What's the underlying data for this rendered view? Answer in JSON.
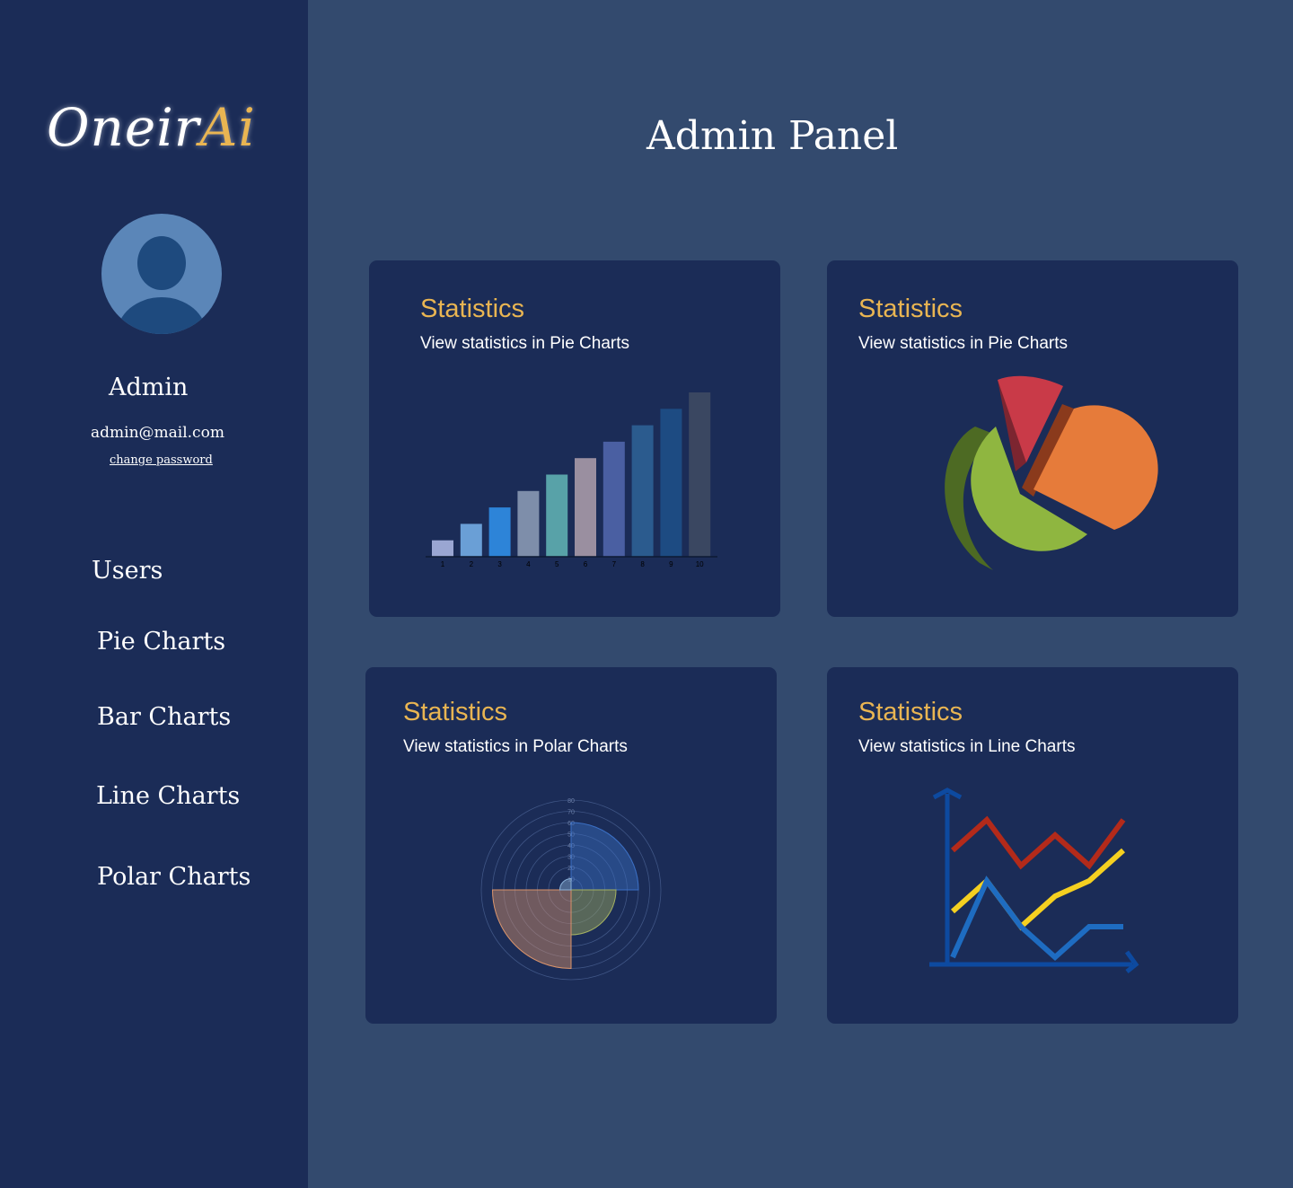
{
  "sidebar": {
    "logo": {
      "part1": "Oneir",
      "part2": "Ai"
    },
    "profile": {
      "name": "Admin",
      "email": "admin@mail.com",
      "change_password": "change password"
    },
    "nav": [
      {
        "label": "Users"
      },
      {
        "label": "Pie Charts"
      },
      {
        "label": "Bar Charts"
      },
      {
        "label": "Line Charts"
      },
      {
        "label": "Polar Charts"
      }
    ]
  },
  "header": {
    "title": "Admin Panel"
  },
  "cards": [
    {
      "title": "Statistics",
      "subtitle": "View statistics in Pie Charts"
    },
    {
      "title": "Statistics",
      "subtitle": "View statistics in Pie Charts"
    },
    {
      "title": "Statistics",
      "subtitle": "View statistics in Polar Charts"
    },
    {
      "title": "Statistics",
      "subtitle": "View statistics in Line Charts"
    }
  ],
  "chart_data": [
    {
      "type": "bar",
      "categories": [
        "1",
        "2",
        "3",
        "4",
        "5",
        "6",
        "7",
        "8",
        "9",
        "10"
      ],
      "values": [
        1,
        2,
        3,
        4,
        5,
        6,
        7,
        8,
        9,
        10
      ],
      "colors": [
        "#9aa6d2",
        "#6a9fd6",
        "#2d84d8",
        "#7e8eaa",
        "#58a2a8",
        "#9a8fa0",
        "#4a5fa2",
        "#2b5b8e",
        "#1d4b82",
        "#3a4761"
      ]
    },
    {
      "type": "pie",
      "slices": [
        {
          "value": 0.58,
          "color": "#8fb640"
        },
        {
          "value": 0.3,
          "color": "#e67b3a"
        },
        {
          "value": 0.12,
          "color": "#c93a48"
        }
      ]
    },
    {
      "type": "polar",
      "r_ticks": [
        10,
        20,
        30,
        40,
        50,
        60,
        70,
        80
      ],
      "series": [
        {
          "value": 60,
          "color": "#3a6fc4"
        },
        {
          "value": 40,
          "color": "#a3b060"
        },
        {
          "value": 70,
          "color": "#d9936a"
        },
        {
          "value": 10,
          "color": "#8ab0d8"
        }
      ]
    },
    {
      "type": "line",
      "series": [
        {
          "color": "#b32a1a",
          "values": [
            7,
            9,
            6,
            8,
            6,
            9
          ]
        },
        {
          "color": "#f5d020",
          "values": [
            3,
            5,
            2,
            4,
            5,
            7
          ]
        },
        {
          "color": "#1e6cc1",
          "values": [
            0,
            5,
            2,
            0,
            2,
            2
          ]
        }
      ],
      "axis_color": "#0d4aa0"
    }
  ]
}
